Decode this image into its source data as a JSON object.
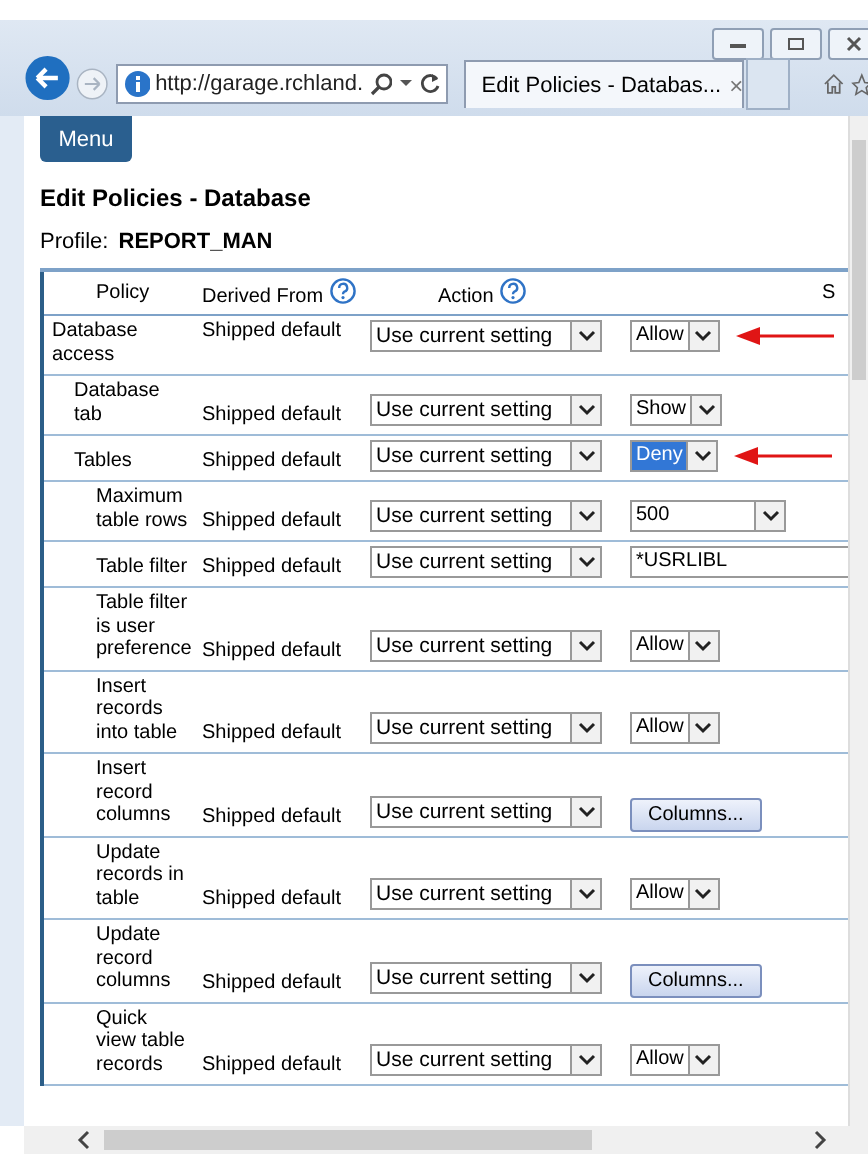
{
  "browser": {
    "address": "http://garage.rchland.",
    "tab_title": "Edit Policies - Databas...",
    "tab_close": "×"
  },
  "menu_button": "Menu",
  "heading": "Edit Policies - Database",
  "profile": {
    "label": "Profile:",
    "value": "REPORT_MAN"
  },
  "table": {
    "columns": [
      {
        "label": "Policy",
        "help": false
      },
      {
        "label": "Derived From",
        "help": true
      },
      {
        "label": "Action",
        "help": true
      },
      {
        "label": "S",
        "help": false
      }
    ],
    "rows": [
      {
        "policy": "Database access",
        "derived": "Shipped default",
        "action": "Use current setting",
        "kind": "select",
        "value": "Allow",
        "value_highlighted": false,
        "marked": true,
        "children": [
          {
            "policy": "Database tab",
            "derived": "Shipped default",
            "action": "Use current setting",
            "kind": "select",
            "value": "Show",
            "value_highlighted": false,
            "marked": false
          },
          {
            "policy": "Tables",
            "derived": "Shipped default",
            "action": "Use current setting",
            "kind": "select",
            "value": "Deny",
            "value_highlighted": true,
            "marked": true,
            "children": [
              {
                "policy": "Maximum table rows",
                "derived": "Shipped default",
                "action": "Use current setting",
                "kind": "wideselect",
                "value": "500",
                "value_highlighted": false,
                "marked": false
              },
              {
                "policy": "Table filter",
                "derived": "Shipped default",
                "action": "Use current setting",
                "kind": "input",
                "value": "*USRLIBL",
                "value_highlighted": false,
                "marked": false
              },
              {
                "policy": "Table filter is user preference",
                "derived": "Shipped default",
                "action": "Use current setting",
                "kind": "select",
                "value": "Allow",
                "value_highlighted": false,
                "marked": false
              },
              {
                "policy": "Insert records into table",
                "derived": "Shipped default",
                "action": "Use current setting",
                "kind": "select",
                "value": "Allow",
                "value_highlighted": false,
                "marked": false
              },
              {
                "policy": "Insert record columns",
                "derived": "Shipped default",
                "action": "Use current setting",
                "kind": "button",
                "value": "Columns...",
                "value_highlighted": false,
                "marked": false
              },
              {
                "policy": "Update records in table",
                "derived": "Shipped default",
                "action": "Use current setting",
                "kind": "select",
                "value": "Allow",
                "value_highlighted": false,
                "marked": false
              },
              {
                "policy": "Update record columns",
                "derived": "Shipped default",
                "action": "Use current setting",
                "kind": "button",
                "value": "Columns...",
                "value_highlighted": false,
                "marked": false
              },
              {
                "policy": "Quick view table records",
                "derived": "Shipped default",
                "action": "Use current setting",
                "kind": "select",
                "value": "Allow",
                "value_highlighted": false,
                "marked": false
              }
            ]
          }
        ]
      }
    ]
  }
}
